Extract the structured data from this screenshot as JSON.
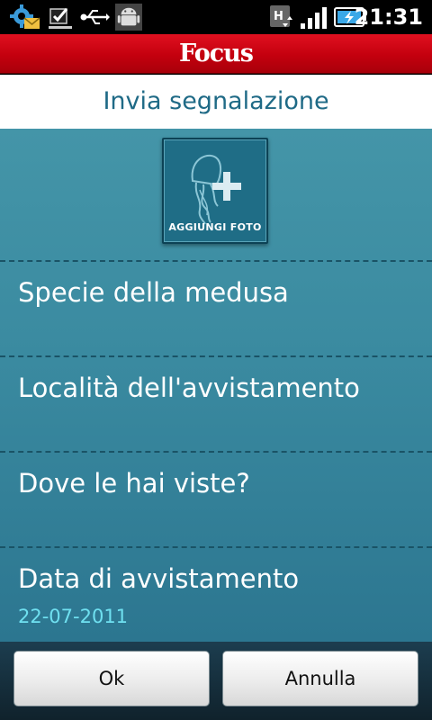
{
  "status_bar": {
    "time": "21:31",
    "icons": [
      "settings-notification-icon",
      "checkbox-notification-icon",
      "usb-icon",
      "android-debug-icon",
      "hspa-data-icon",
      "signal-icon",
      "battery-charging-icon"
    ]
  },
  "app_bar": {
    "logo": "Focus",
    "accent": "#d0000f"
  },
  "page": {
    "title": "Invia segnalazione"
  },
  "photo_button": {
    "label": "AGGIUNGI FOTO",
    "icon": "jellyfish-add-icon"
  },
  "form_rows": [
    {
      "label": "Specie della medusa"
    },
    {
      "label": "Località dell'avvistamento"
    },
    {
      "label": "Dove le hai viste?"
    },
    {
      "label": "Data di avvistamento",
      "value": "22-07-2011"
    }
  ],
  "actions": {
    "ok_label": "Ok",
    "cancel_label": "Annulla"
  }
}
